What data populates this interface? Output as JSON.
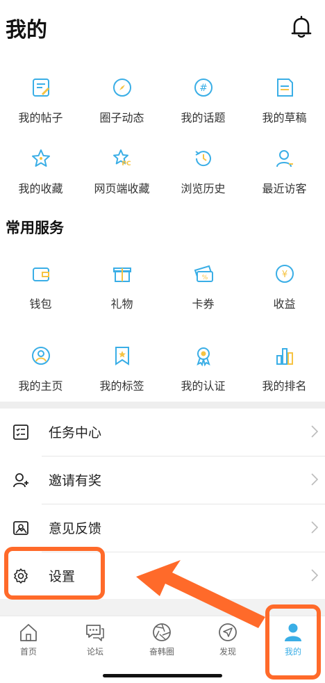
{
  "header": {
    "title": "我的",
    "bell_icon": "bell-icon"
  },
  "quick_grid": [
    {
      "label": "我的帖子",
      "icon": "post-icon"
    },
    {
      "label": "圈子动态",
      "icon": "compass-icon"
    },
    {
      "label": "我的话题",
      "icon": "hashtag-icon"
    },
    {
      "label": "我的草稿",
      "icon": "draft-icon"
    },
    {
      "label": "我的收藏",
      "icon": "star-icon"
    },
    {
      "label": "网页端收藏",
      "icon": "pc-star-icon"
    },
    {
      "label": "浏览历史",
      "icon": "history-icon"
    },
    {
      "label": "最近访客",
      "icon": "visitor-icon"
    }
  ],
  "services": {
    "title": "常用服务",
    "items": [
      {
        "label": "钱包",
        "icon": "wallet-icon"
      },
      {
        "label": "礼物",
        "icon": "gift-icon"
      },
      {
        "label": "卡券",
        "icon": "coupon-icon"
      },
      {
        "label": "收益",
        "icon": "yen-coin-icon"
      },
      {
        "label": "我的主页",
        "icon": "profile-icon"
      },
      {
        "label": "我的标签",
        "icon": "bookmark-star-icon"
      },
      {
        "label": "我的认证",
        "icon": "badge-icon"
      },
      {
        "label": "我的排名",
        "icon": "bar-chart-icon"
      }
    ]
  },
  "list": [
    {
      "label": "任务中心",
      "icon": "task-list-icon"
    },
    {
      "label": "邀请有奖",
      "icon": "add-user-icon"
    },
    {
      "label": "意见反馈",
      "icon": "feedback-icon"
    },
    {
      "label": "设置",
      "icon": "gear-icon"
    }
  ],
  "tabbar": [
    {
      "label": "首页",
      "icon": "home-icon"
    },
    {
      "label": "论坛",
      "icon": "chat-icon"
    },
    {
      "label": "奋韩圈",
      "icon": "aperture-icon"
    },
    {
      "label": "发现",
      "icon": "navigate-icon"
    },
    {
      "label": "我的",
      "icon": "person-icon",
      "active": true
    }
  ],
  "colors": {
    "accent_blue": "#3aaee6",
    "accent_yellow": "#f6c342",
    "highlight_orange": "#ff6a2a",
    "active_tab": "#3aaee6"
  }
}
